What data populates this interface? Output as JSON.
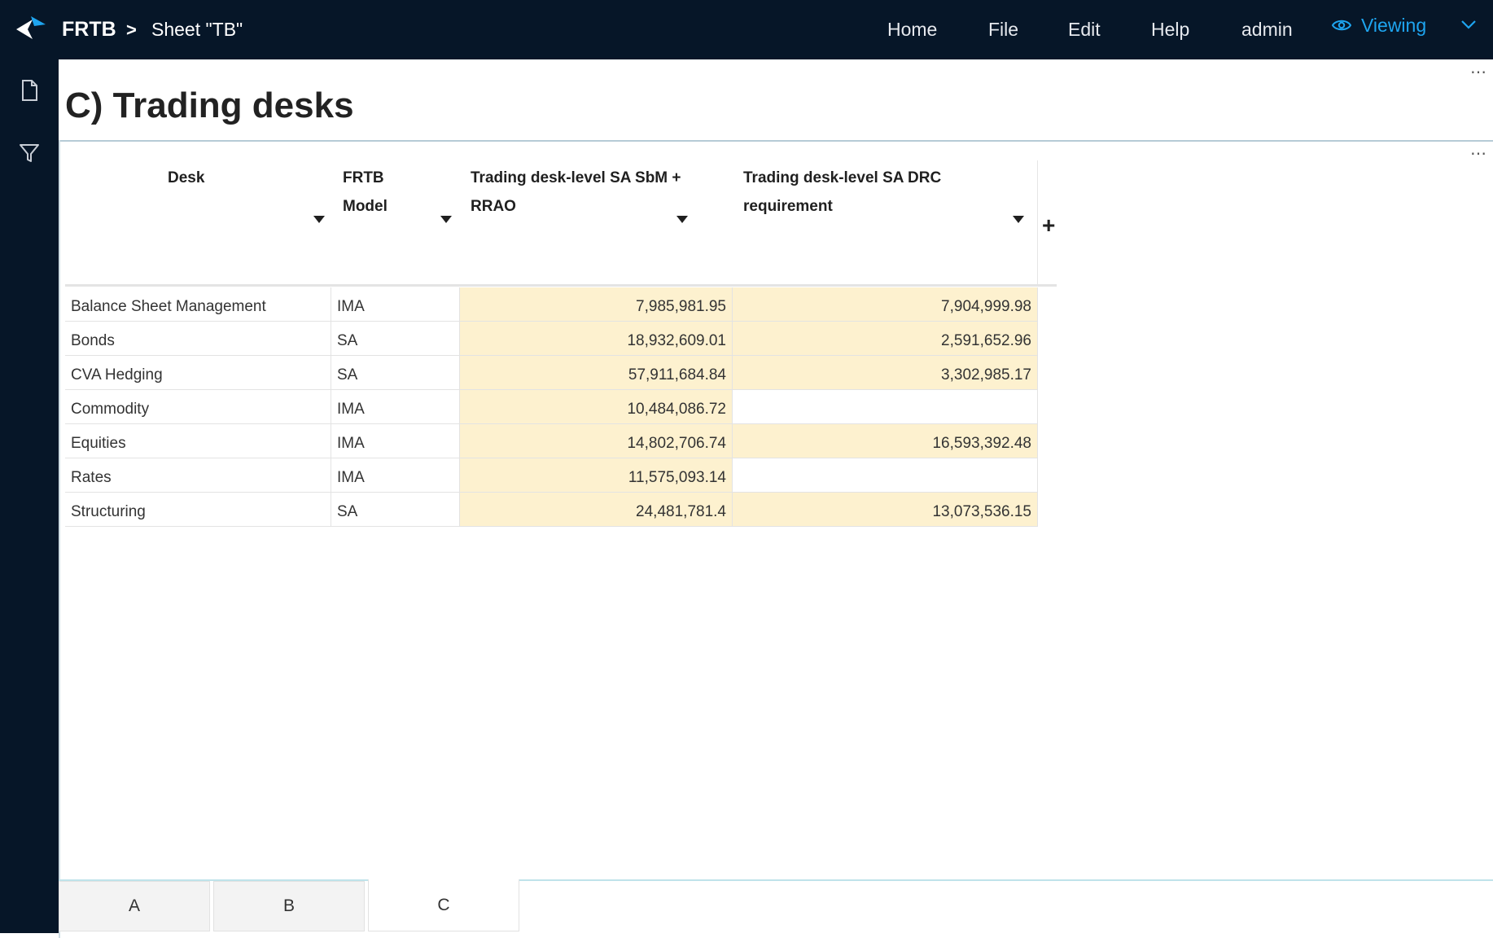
{
  "header": {
    "app_name": "FRTB",
    "separator": ">",
    "sheet_name": "Sheet \"TB\"",
    "nav": [
      "Home",
      "File",
      "Edit",
      "Help",
      "admin"
    ],
    "mode_label": "Viewing",
    "accent_color": "#1ea5f0"
  },
  "sidebar": {
    "icons": [
      "file-icon",
      "filter-icon"
    ]
  },
  "main": {
    "title": "C) Trading desks",
    "more_icon": "⋯"
  },
  "table": {
    "columns": [
      {
        "label": "Desk"
      },
      {
        "label": "FRTB Model"
      },
      {
        "label": "Trading desk-level SA SbM + RRAO"
      },
      {
        "label": "Trading desk-level SA DRC requirement"
      }
    ],
    "add_column_label": "+",
    "rows": [
      {
        "desk": "Balance Sheet Management",
        "model": "IMA",
        "sbm": "7,985,981.95",
        "drc": "7,904,999.98"
      },
      {
        "desk": "Bonds",
        "model": "SA",
        "sbm": "18,932,609.01",
        "drc": "2,591,652.96"
      },
      {
        "desk": "CVA Hedging",
        "model": "SA",
        "sbm": "57,911,684.84",
        "drc": "3,302,985.17"
      },
      {
        "desk": "Commodity",
        "model": "IMA",
        "sbm": "10,484,086.72",
        "drc": ""
      },
      {
        "desk": "Equities",
        "model": "IMA",
        "sbm": "14,802,706.74",
        "drc": "16,593,392.48"
      },
      {
        "desk": "Rates",
        "model": "IMA",
        "sbm": "11,575,093.14",
        "drc": ""
      },
      {
        "desk": "Structuring",
        "model": "SA",
        "sbm": "24,481,781.4",
        "drc": "13,073,536.15"
      }
    ],
    "highlight_color": "#fdf1cf"
  },
  "tabs": [
    {
      "label": "A",
      "active": false
    },
    {
      "label": "B",
      "active": false
    },
    {
      "label": "C",
      "active": true
    }
  ]
}
